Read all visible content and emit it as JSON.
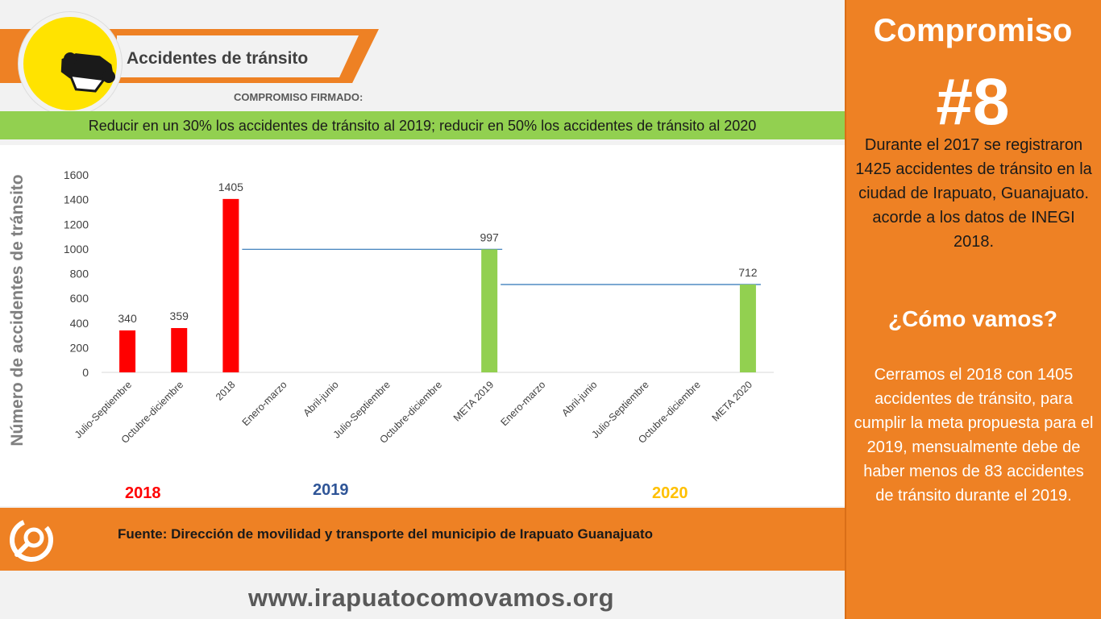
{
  "header": {
    "title": "Accidentes de tránsito",
    "signed_label": "COMPROMISO FIRMADO:",
    "goal": "Reducir en un 30% los accidentes de tránsito al 2019; reducir en 50% los accidentes de tránsito al 2020"
  },
  "chart_data": {
    "type": "bar",
    "title": "",
    "xlabel": "",
    "ylabel": "Número de accidentes de tránsito",
    "ylim": [
      0,
      1600
    ],
    "yticks": [
      0,
      200,
      400,
      600,
      800,
      1000,
      1200,
      1400,
      1600
    ],
    "grid": false,
    "categories": [
      "Julio-Septiembre",
      "Octubre-diciembre",
      "2018",
      "Enero-marzo",
      "Abril-junio",
      "Julio-Septiembre",
      "Octubre-diciembre",
      "META 2019",
      "Enero-marzo",
      "Abril-junio",
      "Julio-Septiembre",
      "Octubre-diciembre",
      "META 2020"
    ],
    "values": [
      340,
      359,
      1405,
      null,
      null,
      null,
      null,
      997,
      null,
      null,
      null,
      null,
      712
    ],
    "bar_colors": [
      "#ff0000",
      "#ff0000",
      "#ff0000",
      null,
      null,
      null,
      null,
      "#92d050",
      null,
      null,
      null,
      null,
      "#92d050"
    ],
    "reference_lines": [
      {
        "from": "2018",
        "to": "META 2019",
        "value": 997,
        "color": "#2e75b6"
      },
      {
        "from": "META 2019",
        "to": "META 2020",
        "value": 712,
        "color": "#2e75b6"
      }
    ],
    "year_groups": [
      {
        "label": "2018",
        "color": "#ff0000"
      },
      {
        "label": "2019",
        "color": "#2f5597"
      },
      {
        "label": "2020",
        "color": "#ffc000"
      }
    ]
  },
  "footer": {
    "source": "Fuente: Dirección de movilidad y transporte del municipio de Irapuato Guanajuato",
    "url": "www.irapuatocomovamos.org"
  },
  "side_panel": {
    "title": "Compromiso",
    "number": "#8",
    "description": "Durante el 2017 se registraron 1425 accidentes de tránsito en la ciudad de Irapuato, Guanajuato. acorde a los datos de INEGI 2018.",
    "how_label": "¿Cómo vamos?",
    "status": "Cerramos el 2018 con 1405 accidentes de tránsito, para cumplir la meta propuesta para el 2019, mensualmente debe de haber menos de 83 accidentes de tránsito durante el 2019."
  },
  "colors": {
    "orange": "#ee8124",
    "green": "#92d050",
    "red": "#ff0000",
    "yellow": "#ffe300"
  },
  "icons": {
    "logo": "overturned-car-icon",
    "source_logo": "irapuato-como-vamos-logo"
  }
}
